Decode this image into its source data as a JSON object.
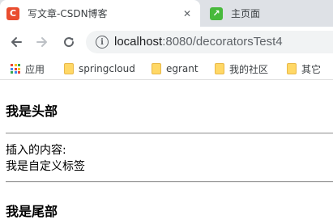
{
  "tabs": [
    {
      "title": "写文章-CSDN博客",
      "favicon_letter": "C",
      "favicon_color": "#e94d2f",
      "close_glyph": "✕",
      "active": true
    },
    {
      "title": "主页面",
      "favicon_letter": "↗",
      "favicon_color": "#48b93c",
      "active": false
    }
  ],
  "toolbar": {
    "back_icon": "arrow-left",
    "forward_icon": "arrow-right",
    "reload_icon": "reload",
    "info_glyph": "i"
  },
  "address": {
    "host": "localhost",
    "path": ":8080/decoratorsTest4"
  },
  "bookmarks": [
    {
      "label": "应用",
      "icon": "apps-grid"
    },
    {
      "label": "springcloud",
      "icon": "folder"
    },
    {
      "label": "egrant",
      "icon": "folder"
    },
    {
      "label": "我的社区",
      "icon": "folder"
    },
    {
      "label": "其它",
      "icon": "folder"
    }
  ],
  "apps_grid_colors": [
    "#ea4335",
    "#fbbc05",
    "#34a853",
    "#4285f4",
    "#ea4335",
    "#fbbc05",
    "#34a853",
    "#4285f4",
    "#ea4335"
  ],
  "page": {
    "header": "我是头部",
    "inserted_label": "插入的内容:",
    "custom_tag": "我是自定义标签",
    "footer": "我是尾部"
  }
}
